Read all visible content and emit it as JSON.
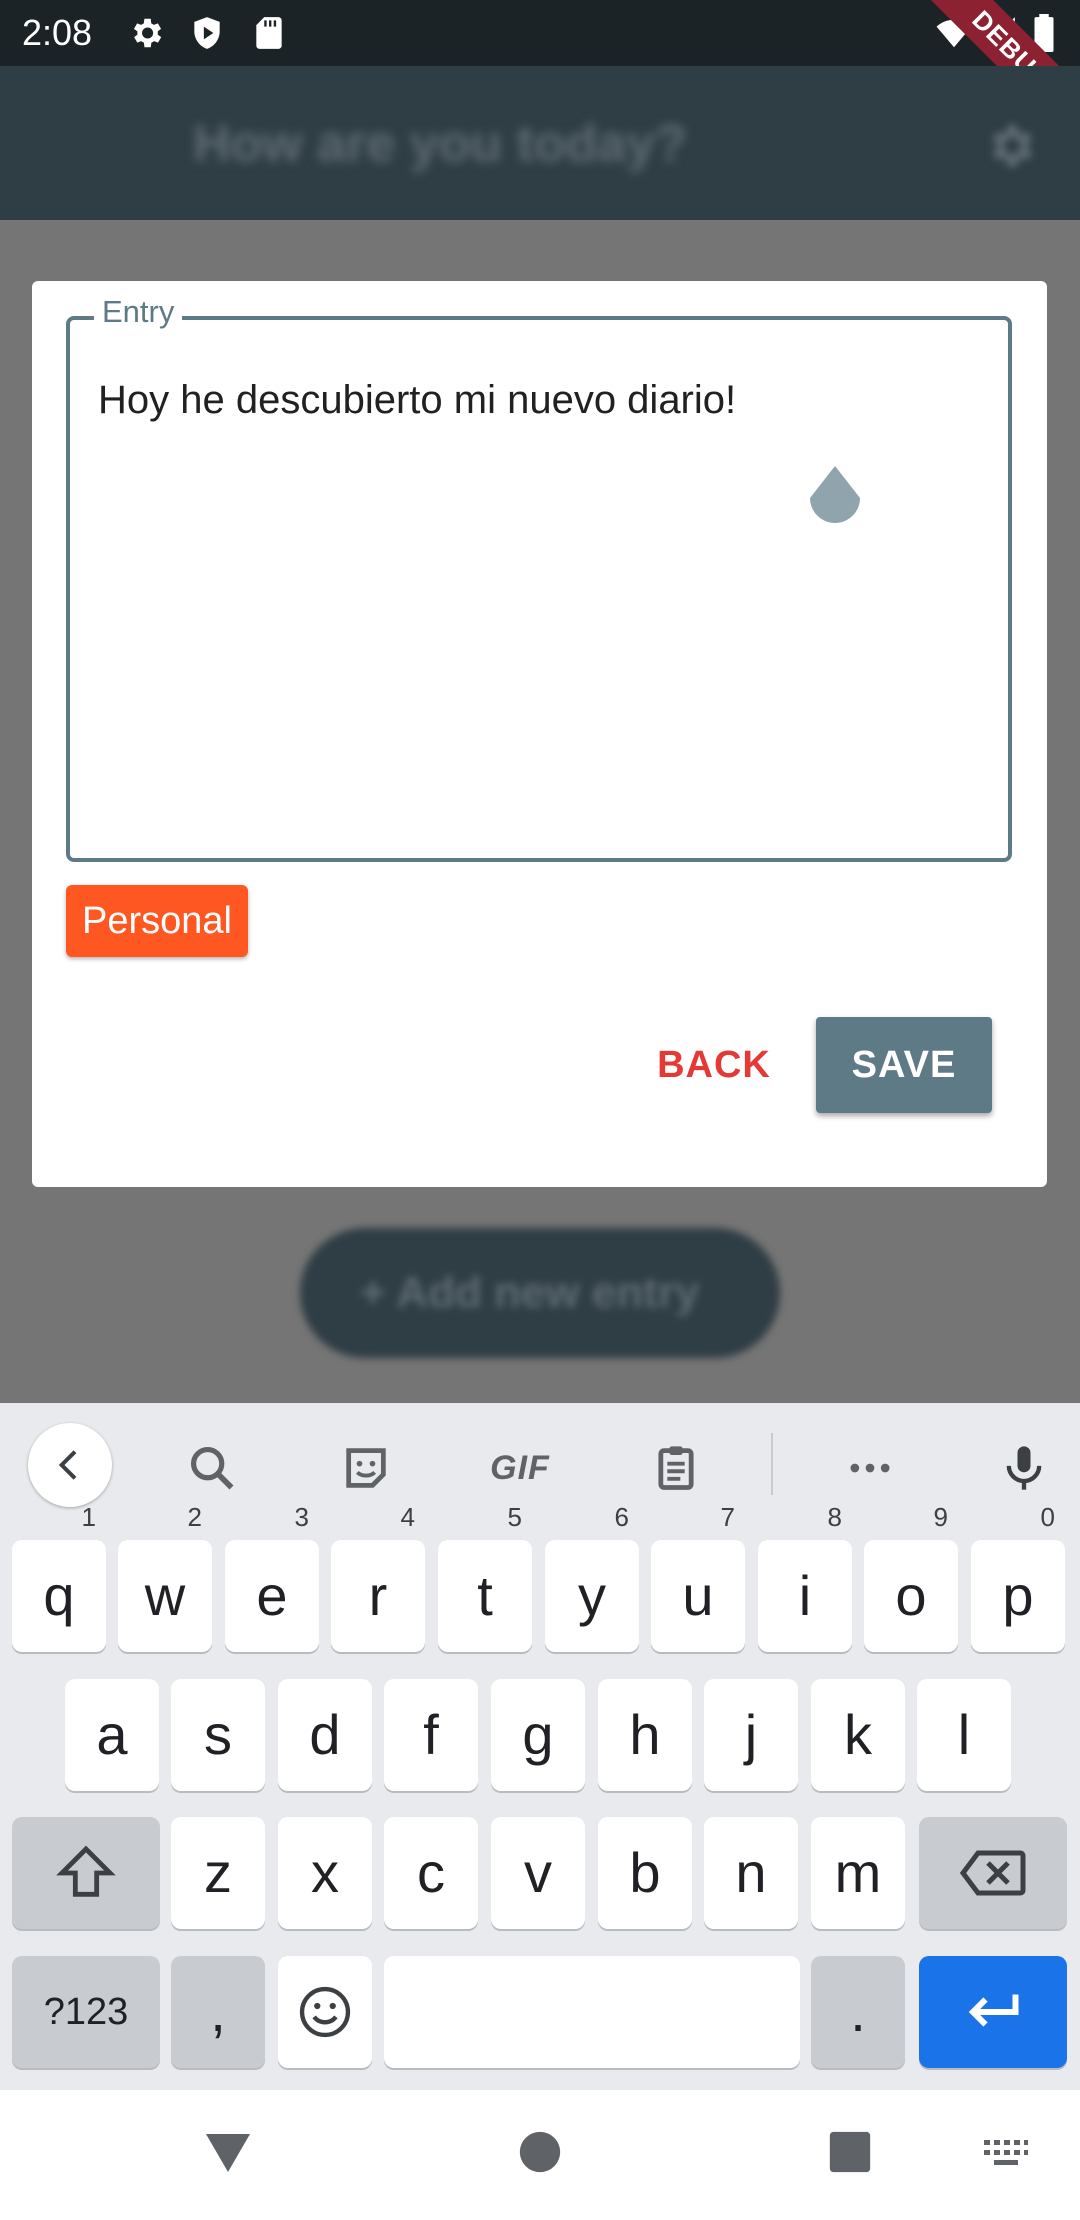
{
  "status_bar": {
    "time": "2:08",
    "debug": "DEBUG"
  },
  "app": {
    "title": "How are you today?",
    "fab_label": "+ Add new entry"
  },
  "dialog": {
    "entry_label": "Entry",
    "entry_text": "Hoy he descubierto mi nuevo diario!",
    "tag": "Personal",
    "back": "BACK",
    "save": "SAVE"
  },
  "keyboard": {
    "toolbar": [
      "back-icon",
      "search-icon",
      "sticker-icon",
      "gif",
      "clipboard-icon",
      "more-icon",
      "mic-icon"
    ],
    "gif_label": "GIF",
    "row1": [
      {
        "k": "q",
        "h": "1"
      },
      {
        "k": "w",
        "h": "2"
      },
      {
        "k": "e",
        "h": "3"
      },
      {
        "k": "r",
        "h": "4"
      },
      {
        "k": "t",
        "h": "5"
      },
      {
        "k": "y",
        "h": "6"
      },
      {
        "k": "u",
        "h": "7"
      },
      {
        "k": "i",
        "h": "8"
      },
      {
        "k": "o",
        "h": "9"
      },
      {
        "k": "p",
        "h": "0"
      }
    ],
    "row2": [
      "a",
      "s",
      "d",
      "f",
      "g",
      "h",
      "j",
      "k",
      "l"
    ],
    "row3": [
      "z",
      "x",
      "c",
      "v",
      "b",
      "n",
      "m"
    ],
    "symbols_key": "?123",
    "comma_key": ",",
    "period_key": "."
  },
  "colors": {
    "accent": "#5f7a87",
    "tag": "#ff5722",
    "back": "#e53935",
    "enter": "#1a73e8"
  }
}
